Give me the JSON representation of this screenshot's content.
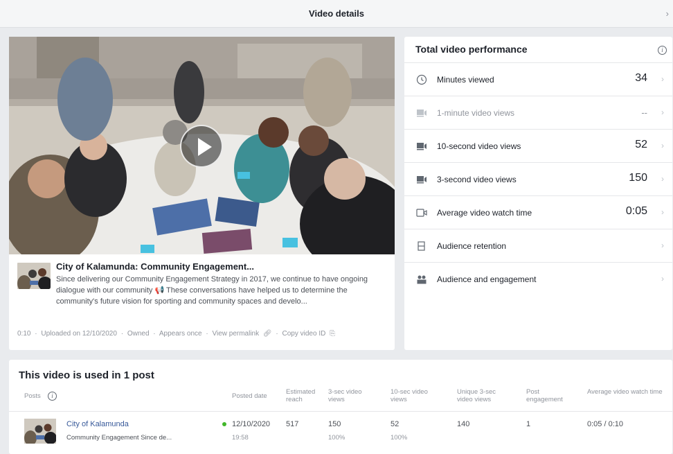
{
  "header": {
    "title": "Video details",
    "close_label": "›"
  },
  "video": {
    "title": "City of Kalamunda: Community Engagement...",
    "description": "Since delivering our Community Engagement Strategy in 2017, we continue to have ongoing dialogue with our community 📢 These conversations have helped us to determine the community's future vision for sporting and community spaces and develo...",
    "footer": {
      "duration": "0:10",
      "uploaded": "Uploaded on 12/10/2020",
      "owned": "Owned",
      "appears": "Appears once",
      "permalink": "View permalink",
      "copy_id": "Copy video ID",
      "sep": "·"
    }
  },
  "performance": {
    "title": "Total video performance",
    "info": "i",
    "rows": [
      {
        "label": "Minutes viewed",
        "value": "34",
        "icon": "clock-icon"
      },
      {
        "label": "1-minute video views",
        "value": "--",
        "icon": "video-views-icon"
      },
      {
        "label": "10-second video views",
        "value": "52",
        "icon": "video-views-icon"
      },
      {
        "label": "3-second video views",
        "value": "150",
        "icon": "video-views-icon"
      },
      {
        "label": "Average video watch time",
        "value": "0:05",
        "icon": "video-camera-icon"
      },
      {
        "label": "Audience retention",
        "value": "",
        "icon": "retention-icon"
      },
      {
        "label": "Audience and engagement",
        "value": "",
        "icon": "people-icon"
      }
    ],
    "chevron": "›"
  },
  "posts": {
    "title": "This video is used in 1 post",
    "info": "i",
    "columns": {
      "posts": "Posts",
      "posted_date": "Posted date",
      "reach": "Estimated reach",
      "views3": "3-sec video views",
      "views10": "10-sec video views",
      "unique3": "Unique 3-sec video views",
      "engagement": "Post engagement",
      "watch_time": "Average video watch time"
    },
    "rows": [
      {
        "name": "City of Kalamunda",
        "subtitle": "Community Engagement Since de...",
        "date": "12/10/2020",
        "time": "19:58",
        "reach": "517",
        "views3": "150",
        "views3_pct": "100%",
        "views10": "52",
        "views10_pct": "100%",
        "unique3": "140",
        "engagement": "1",
        "watch_time": "0:05 / 0:10"
      }
    ]
  },
  "colors": {
    "link": "#365899",
    "status_dot": "#42b72a"
  }
}
